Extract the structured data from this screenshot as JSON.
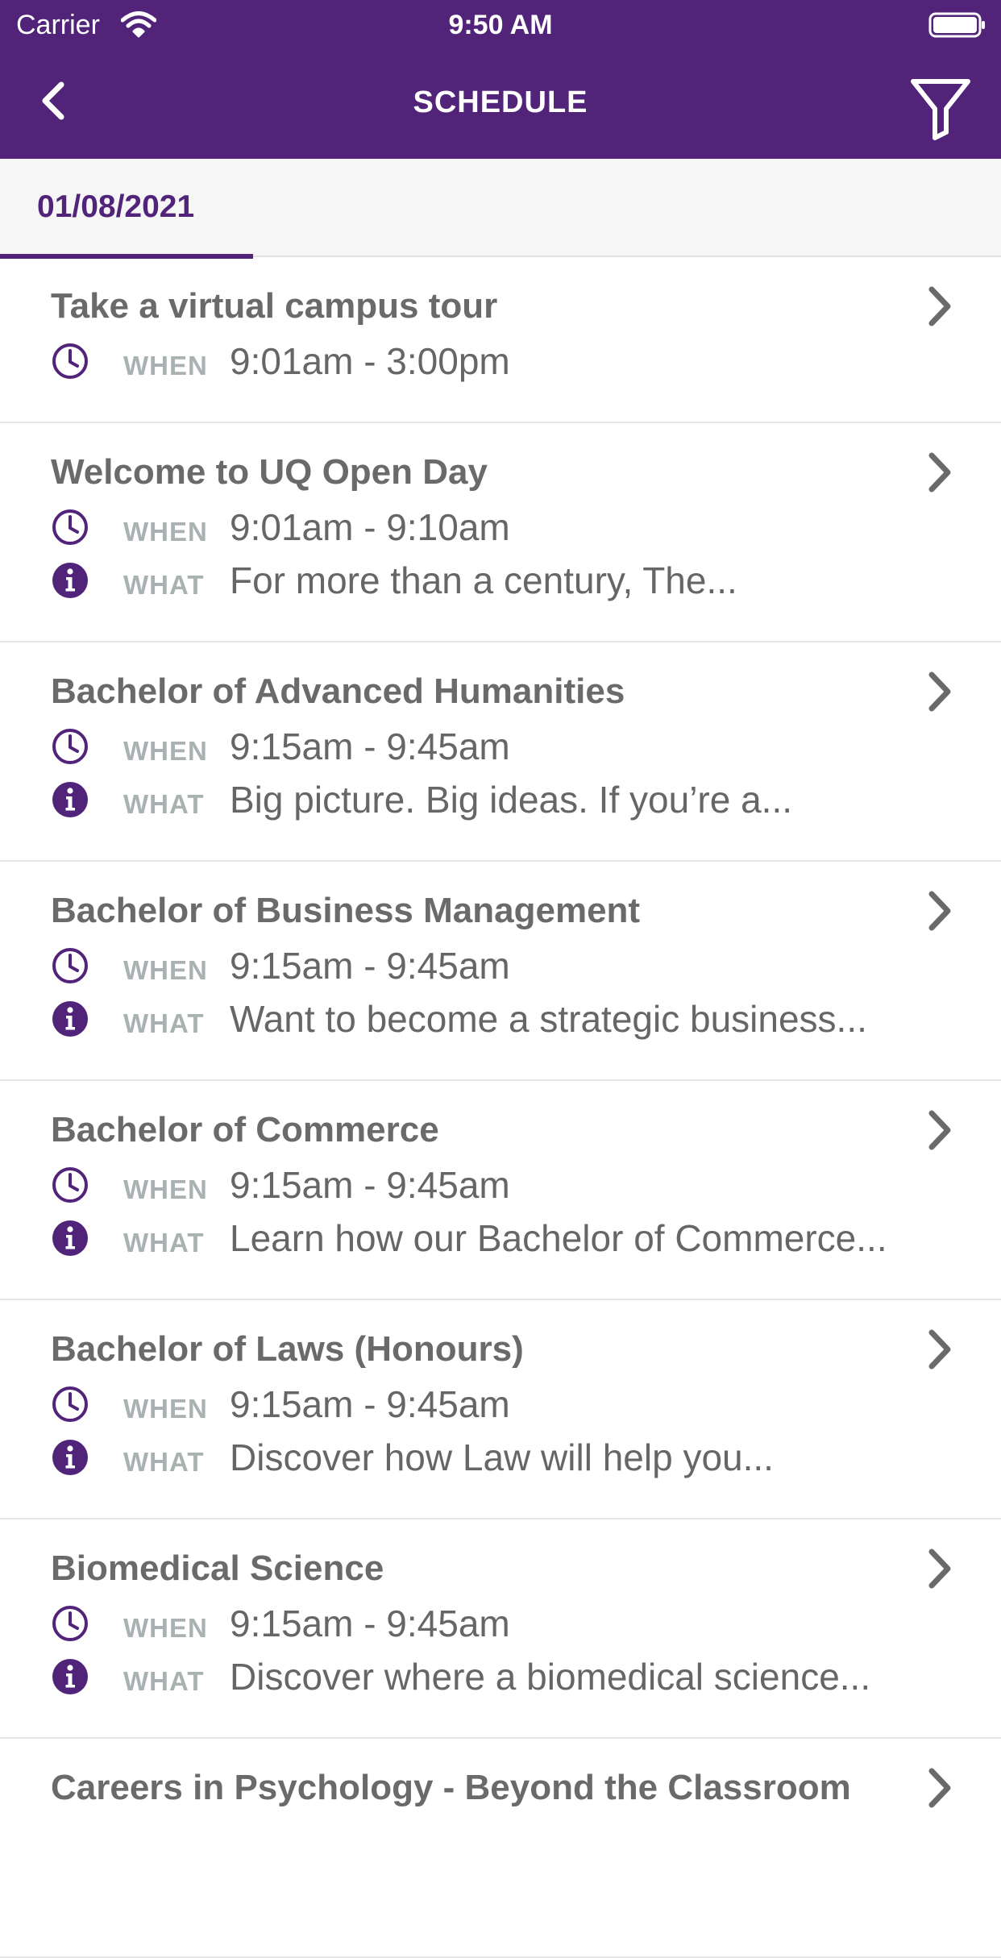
{
  "status_bar": {
    "carrier": "Carrier",
    "time": "9:50 AM"
  },
  "nav": {
    "title": "SCHEDULE",
    "back_icon": "chevron-left-icon",
    "filter_icon": "filter-icon"
  },
  "tabs": [
    {
      "label": "01/08/2021",
      "selected": true
    }
  ],
  "labels": {
    "when": "WHEN",
    "what": "WHAT"
  },
  "colors": {
    "brand": "#512479",
    "title_text": "#6a6a6a",
    "label_text": "#a9b2b2"
  },
  "events": [
    {
      "title": "Take a virtual campus tour",
      "when": "9:01am - 3:00pm",
      "what": ""
    },
    {
      "title": "Welcome to UQ Open Day",
      "when": "9:01am - 9:10am",
      "what": "For more than a century, The..."
    },
    {
      "title": "Bachelor of Advanced Humanities",
      "when": "9:15am - 9:45am",
      "what": "Big picture. Big ideas. If you’re a..."
    },
    {
      "title": "Bachelor of Business Management",
      "when": "9:15am - 9:45am",
      "what": "Want to become a strategic business..."
    },
    {
      "title": "Bachelor of Commerce",
      "when": "9:15am - 9:45am",
      "what": "Learn how our Bachelor of Commerce..."
    },
    {
      "title": "Bachelor of Laws (Honours)",
      "when": "9:15am - 9:45am",
      "what": "Discover how Law will help you..."
    },
    {
      "title": "Biomedical Science",
      "when": "9:15am - 9:45am",
      "what": "Discover where a biomedical science..."
    },
    {
      "title": "Careers in Psychology - Beyond the Classroom",
      "when": "",
      "what": ""
    }
  ]
}
